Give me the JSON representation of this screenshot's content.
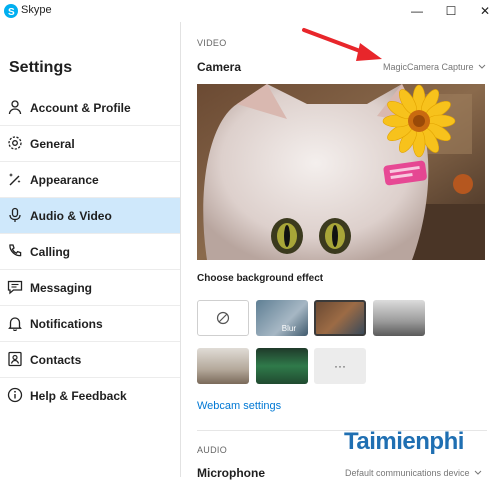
{
  "window": {
    "title": "Skype",
    "minimize": "—",
    "maximize": "☐",
    "close": "✕"
  },
  "sidebar": {
    "title": "Settings",
    "items": [
      {
        "label": "Account & Profile",
        "icon": "person-icon"
      },
      {
        "label": "General",
        "icon": "gear-icon"
      },
      {
        "label": "Appearance",
        "icon": "magic-wand-icon"
      },
      {
        "label": "Audio & Video",
        "icon": "microphone-icon",
        "active": true
      },
      {
        "label": "Calling",
        "icon": "phone-icon"
      },
      {
        "label": "Messaging",
        "icon": "chat-icon"
      },
      {
        "label": "Notifications",
        "icon": "bell-icon"
      },
      {
        "label": "Contacts",
        "icon": "contacts-icon"
      },
      {
        "label": "Help & Feedback",
        "icon": "info-icon"
      }
    ]
  },
  "video": {
    "section_label": "VIDEO",
    "camera_label": "Camera",
    "camera_device": "MagicCamera Capture"
  },
  "background_effect": {
    "label": "Choose background effect",
    "tiles": [
      {
        "name": "none",
        "label": ""
      },
      {
        "name": "blur",
        "label": "Blur"
      },
      {
        "name": "office",
        "label": ""
      },
      {
        "name": "room",
        "label": ""
      },
      {
        "name": "window",
        "label": ""
      },
      {
        "name": "green-room",
        "label": ""
      },
      {
        "name": "more",
        "label": "···"
      }
    ]
  },
  "webcam_settings_link": "Webcam settings",
  "audio": {
    "section_label": "AUDIO",
    "microphone_label": "Microphone",
    "microphone_device": "Default communications device"
  },
  "watermark": "Taimienphi",
  "colors": {
    "accent": "#0078d4",
    "active_nav": "#cfe8fb",
    "arrow": "#e8262b"
  }
}
